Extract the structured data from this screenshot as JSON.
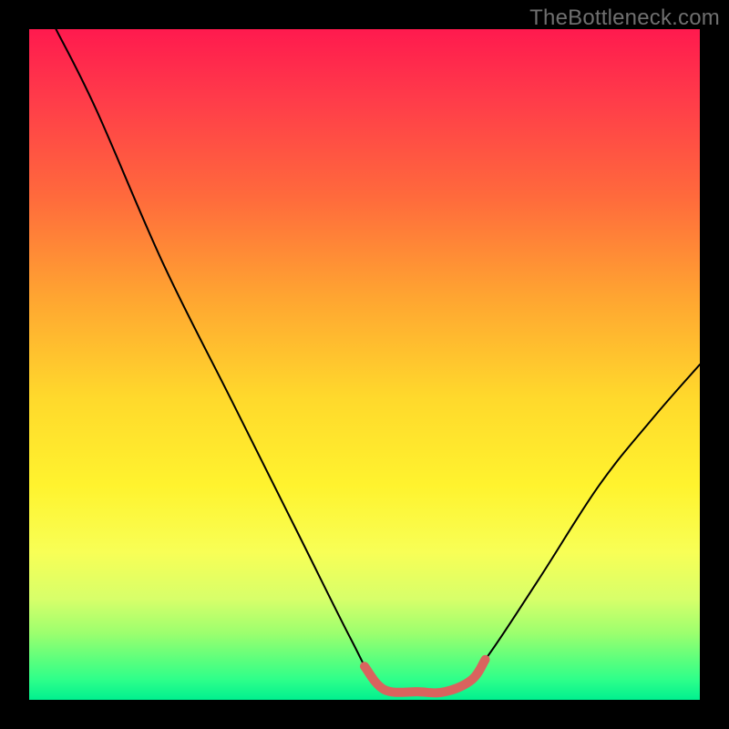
{
  "watermark": "TheBottleneck.com",
  "chart_data": {
    "type": "line",
    "title": "",
    "xlabel": "",
    "ylabel": "",
    "xlim": [
      0,
      100
    ],
    "ylim": [
      0,
      100
    ],
    "series": [
      {
        "name": "black-curve",
        "color": "#000000",
        "points": [
          {
            "x": 4,
            "y": 100
          },
          {
            "x": 10,
            "y": 88
          },
          {
            "x": 20,
            "y": 65
          },
          {
            "x": 30,
            "y": 45
          },
          {
            "x": 40,
            "y": 25
          },
          {
            "x": 48,
            "y": 9
          },
          {
            "x": 52,
            "y": 2
          },
          {
            "x": 56,
            "y": 1
          },
          {
            "x": 60,
            "y": 1
          },
          {
            "x": 64,
            "y": 2
          },
          {
            "x": 68,
            "y": 6
          },
          {
            "x": 76,
            "y": 18
          },
          {
            "x": 85,
            "y": 32
          },
          {
            "x": 93,
            "y": 42
          },
          {
            "x": 100,
            "y": 50
          }
        ]
      },
      {
        "name": "red-highlight",
        "color": "#d9635e",
        "points": [
          {
            "x": 50,
            "y": 5
          },
          {
            "x": 53,
            "y": 1.5
          },
          {
            "x": 58,
            "y": 1.2
          },
          {
            "x": 62,
            "y": 1.2
          },
          {
            "x": 66,
            "y": 3
          },
          {
            "x": 68,
            "y": 6
          }
        ]
      }
    ],
    "background_gradient": {
      "top": "#ff1a4e",
      "bottom": "#00f08f"
    }
  }
}
